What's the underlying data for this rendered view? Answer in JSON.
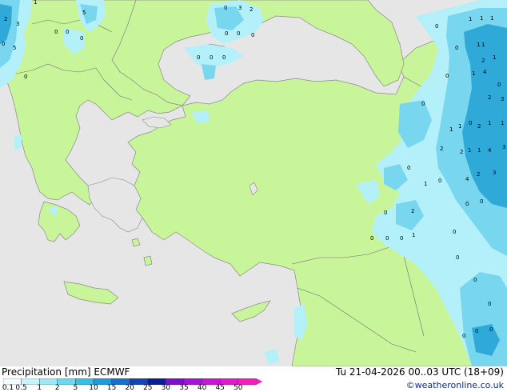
{
  "map": {
    "region": "Eastern Mediterranean / Turkey",
    "colors": {
      "sea": "#e6e6e6",
      "land": "#c9f59a",
      "coast": "#8a8a8a",
      "border": "#6e6e6e",
      "precip_light": "#b4f0fa",
      "precip_mid": "#78d6ee",
      "precip_heavy": "#2fa9d8"
    },
    "labels": [
      {
        "text": "2"
      },
      {
        "text": "3"
      },
      {
        "text": "5"
      },
      {
        "text": "0"
      },
      {
        "text": "0"
      },
      {
        "text": "1"
      },
      {
        "text": "5"
      },
      {
        "text": "0"
      },
      {
        "text": "0"
      },
      {
        "text": "0"
      },
      {
        "text": "3"
      },
      {
        "text": "2"
      },
      {
        "text": "0"
      },
      {
        "text": "0"
      },
      {
        "text": "0"
      },
      {
        "text": "0"
      },
      {
        "text": "0"
      },
      {
        "text": "0"
      },
      {
        "text": "0"
      },
      {
        "text": "0"
      },
      {
        "text": "1"
      },
      {
        "text": "1"
      },
      {
        "text": "1"
      },
      {
        "text": "1"
      },
      {
        "text": "0"
      },
      {
        "text": "1"
      },
      {
        "text": "2"
      },
      {
        "text": "1"
      },
      {
        "text": "4"
      },
      {
        "text": "1"
      },
      {
        "text": "0"
      },
      {
        "text": "0"
      },
      {
        "text": "2"
      },
      {
        "text": "3"
      },
      {
        "text": "0"
      },
      {
        "text": "1"
      },
      {
        "text": "1"
      },
      {
        "text": "0"
      },
      {
        "text": "2"
      },
      {
        "text": "1"
      },
      {
        "text": "1"
      },
      {
        "text": "2"
      },
      {
        "text": "1"
      },
      {
        "text": "1"
      },
      {
        "text": "4"
      },
      {
        "text": "2"
      },
      {
        "text": "3"
      },
      {
        "text": "2"
      },
      {
        "text": "3"
      },
      {
        "text": "0"
      },
      {
        "text": "4"
      },
      {
        "text": "0"
      },
      {
        "text": "1"
      },
      {
        "text": "2"
      },
      {
        "text": "0"
      },
      {
        "text": "0"
      },
      {
        "text": "1"
      },
      {
        "text": "0"
      },
      {
        "text": "0"
      },
      {
        "text": "0"
      },
      {
        "text": "0"
      },
      {
        "text": "0"
      },
      {
        "text": "0"
      },
      {
        "text": "0"
      },
      {
        "text": "0"
      },
      {
        "text": "0"
      },
      {
        "text": "0"
      },
      {
        "text": "0"
      }
    ]
  },
  "footer": {
    "title": "Precipitation [mm]  ECMWF",
    "valid_time": "Tu 21-04-2026 00..03 UTC (18+09)",
    "credit": "©weatheronline.co.uk"
  },
  "colorbar": {
    "stops": [
      {
        "label": "0.1",
        "color": "#f0fcfe"
      },
      {
        "label": "0.5",
        "color": "#c7f3fb"
      },
      {
        "label": "1",
        "color": "#9ee8f6"
      },
      {
        "label": "2",
        "color": "#6fd8f0"
      },
      {
        "label": "5",
        "color": "#3bbfe6"
      },
      {
        "label": "10",
        "color": "#1f9bd8"
      },
      {
        "label": "15",
        "color": "#1a6fc9"
      },
      {
        "label": "20",
        "color": "#1544b3"
      },
      {
        "label": "25",
        "color": "#0c1f8f"
      },
      {
        "label": "30",
        "color": "#7a10c8"
      },
      {
        "label": "35",
        "color": "#a314d6"
      },
      {
        "label": "40",
        "color": "#c418d6"
      },
      {
        "label": "45",
        "color": "#de1cc9"
      },
      {
        "label": "50",
        "color": "#f020b8"
      }
    ]
  }
}
